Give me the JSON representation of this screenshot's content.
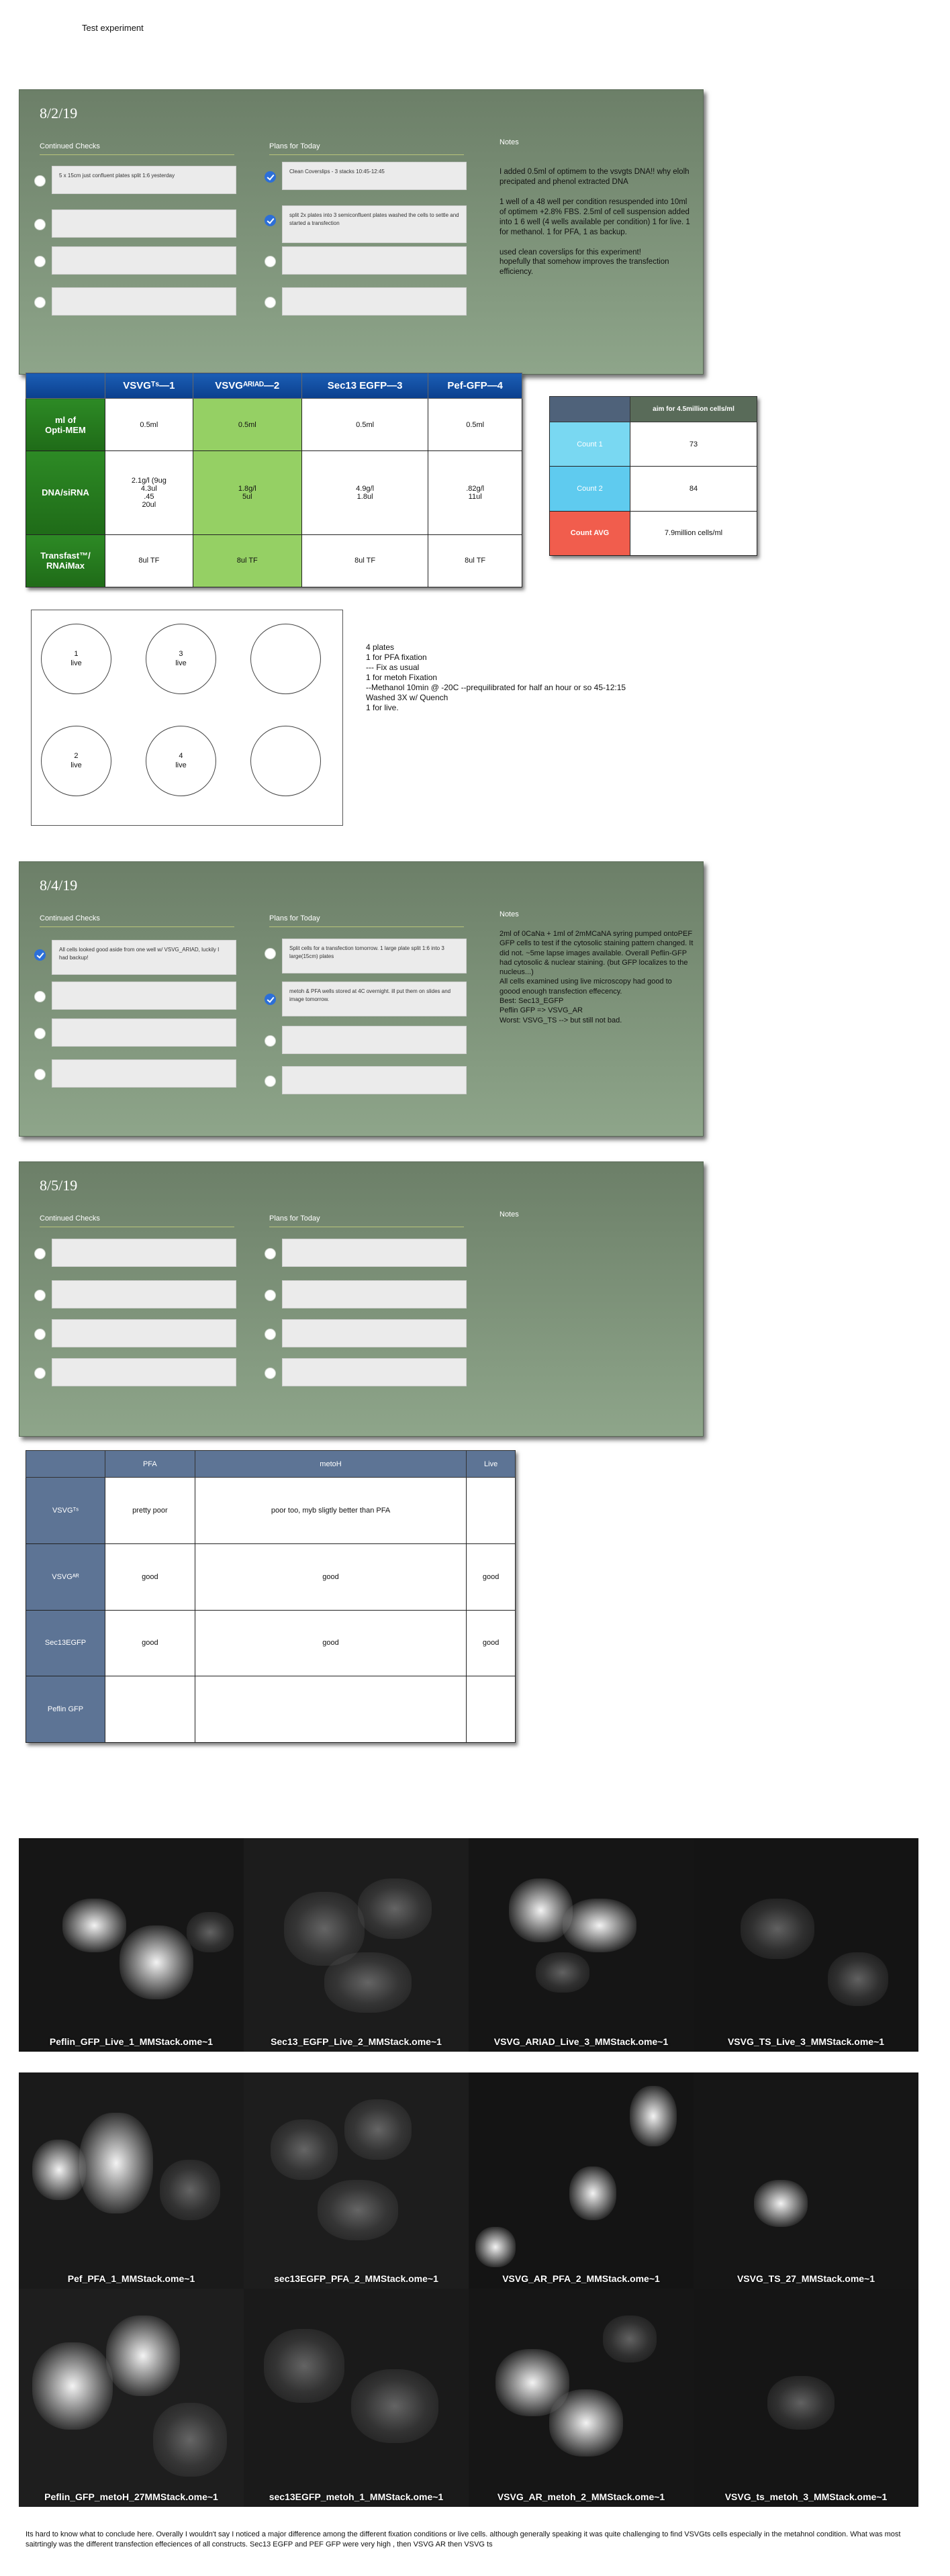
{
  "title": "Test experiment",
  "cards": [
    {
      "date": "8/2/19",
      "checks_title": "Continued Checks",
      "plans_title": "Plans for Today",
      "notes_title": "Notes",
      "checks": [
        {
          "checked": false,
          "text": "5 x 15cm just confluent plates split 1:6 yesterday"
        },
        {
          "checked": false,
          "text": ""
        },
        {
          "checked": false,
          "text": ""
        },
        {
          "checked": false,
          "text": ""
        }
      ],
      "plans": [
        {
          "checked": true,
          "text": "Clean Coverslips - 3 stacks 10:45-12:45"
        },
        {
          "checked": true,
          "text": "split 2x plates into 3 semiconfluent plates washed the cells to settle and started a transfection"
        },
        {
          "checked": false,
          "text": ""
        },
        {
          "checked": false,
          "text": ""
        }
      ],
      "notes": "I added 0.5ml of optimem to the vsvgts DNA!! why elolh precipated and phenol extracted DNA\n\n1 well of a 48 well per condition resuspended into 10ml of optimem +2.8% FBS. 2.5ml of cell suspension added into 1 6 well (4 wells available per condition) 1 for live. 1 for methanol. 1 for PFA, 1 as backup.\n\nused clean coverslips for this experiment!\nhopefully that somehow improves the transfection efficiency."
    },
    {
      "date": "8/4/19",
      "checks_title": "Continued Checks",
      "plans_title": "Plans for Today",
      "notes_title": "Notes",
      "checks": [
        {
          "checked": true,
          "text": "All cells looked good aside from one well w/ VSVG_ARIAD, luckily I had backup!"
        },
        {
          "checked": false,
          "text": ""
        },
        {
          "checked": false,
          "text": ""
        },
        {
          "checked": false,
          "text": ""
        }
      ],
      "plans": [
        {
          "checked": false,
          "text": "Split cells for a transfection tomorrow. 1 large plate split 1:6 into 3 large(15cm) plates"
        },
        {
          "checked": true,
          "text": "metoh & PFA wells stored at 4C overnight. ill put them on slides and image tomorrow."
        },
        {
          "checked": false,
          "text": ""
        },
        {
          "checked": false,
          "text": ""
        }
      ],
      "notes": "2ml of 0CaNa + 1ml of 2mMCaNA  syring pumped ontoPEF GFP cells to test if the cytosolic staining pattern changed. It did not. ~5me lapse images available. Overall Peflin-GFP had cytosolic & nuclear staining. (but GFP localizes to the nucleus...)\nAll cells examined using live microscopy had good to goood enough transfection effecency.\nBest: Sec13_EGFP\n        Peflin GFP => VSVG_AR\nWorst: VSVG_TS --> but still not bad."
    },
    {
      "date": "8/5/19",
      "checks_title": "Continued Checks",
      "plans_title": "Plans for Today",
      "notes_title": "Notes",
      "checks": [
        {
          "checked": false,
          "text": ""
        },
        {
          "checked": false,
          "text": ""
        },
        {
          "checked": false,
          "text": ""
        },
        {
          "checked": false,
          "text": ""
        }
      ],
      "plans": [
        {
          "checked": false,
          "text": ""
        },
        {
          "checked": false,
          "text": ""
        },
        {
          "checked": false,
          "text": ""
        },
        {
          "checked": false,
          "text": ""
        }
      ],
      "notes": ""
    }
  ],
  "transfection_table": {
    "headers": [
      "",
      "VSVGᵀˢ—1",
      "VSVGᴬᴿᴵᴬᴰ—2",
      "Sec13 EGFP—3",
      "Pef-GFP—4"
    ],
    "rows": [
      {
        "label": "ml of\nOpti-MEM",
        "cells": [
          "0.5ml",
          "0.5ml",
          "0.5ml",
          "0.5ml"
        ]
      },
      {
        "label": "DNA/siRNA",
        "cells": [
          "2.1g/l (9ug\n4.3ul\n.45\n20ul",
          "1.8g/l\n5ul",
          "4.9g/l\n1.8ul",
          ".82g/l\n11ul"
        ]
      },
      {
        "label": "Transfast™/\nRNAiMax",
        "cells": [
          "8ul TF",
          "8ul TF",
          "8ul TF",
          "8ul TF"
        ]
      }
    ],
    "highlight_column": 1
  },
  "count_table": {
    "header": "aim for 4.5million cells/ml",
    "rows": [
      {
        "label": "Count 1",
        "value": "73"
      },
      {
        "label": "Count 2",
        "value": "84"
      },
      {
        "label": "Count AVG",
        "value": "7.9million cells/ml"
      }
    ]
  },
  "plate": {
    "wells": [
      "1\nlive",
      "3\nlive",
      "",
      "2\nlive",
      "4\nlive",
      ""
    ],
    "notes": "4 plates\n1 for PFA fixation\n--- Fix as usual\n1 for metoh Fixation\n--Methanol 10min @ -20C --prequilibrated for half an hour or so 45-12:15\nWashed 3X w/ Quench\n1 for live."
  },
  "fixation_table": {
    "headers": [
      "",
      "PFA",
      "metoH",
      "Live"
    ],
    "rows": [
      {
        "label": "VSVGᵀˢ",
        "cells": [
          "pretty poor",
          "poor too, myb sligtly better than PFA",
          ""
        ]
      },
      {
        "label": "VSVGᴬᴿ",
        "cells": [
          "good",
          "good",
          "good"
        ]
      },
      {
        "label": "Sec13EGFP",
        "cells": [
          "good",
          "good",
          "good"
        ]
      },
      {
        "label": "Peflin GFP",
        "cells": [
          "",
          "",
          ""
        ]
      }
    ]
  },
  "images": [
    [
      "Peflin_GFP_Live_1_MMStack.ome~1",
      "Sec13_EGFP_Live_2_MMStack.ome~1",
      "VSVG_ARIAD_Live_3_MMStack.ome~1",
      "VSVG_TS_Live_3_MMStack.ome~1"
    ],
    [
      "Pef_PFA_1_MMStack.ome~1",
      "sec13EGFP_PFA_2_MMStack.ome~1",
      "VSVG_AR_PFA_2_MMStack.ome~1",
      "VSVG_TS_27_MMStack.ome~1"
    ],
    [
      "Peflin_GFP_metoH_27MMStack.ome~1",
      "sec13EGFP_metoh_1_MMStack.ome~1",
      "VSVG_AR_metoh_2_MMStack.ome~1",
      "VSVG_ts_metoh_3_MMStack.ome~1"
    ]
  ],
  "conclusion": "Its hard to know what to conclude here. Overally I wouldn't say I noticed a major difference among the different fixation conditions or live cells. although generally speaking it was quite challenging to find VSVGts cells especially in the metahnol condition. What was most saitrtingly was the different transfection effeciences of all constructs. Sec13 EGFP and PEF GFP were very high , then VSVG AR then VSVG ts"
}
